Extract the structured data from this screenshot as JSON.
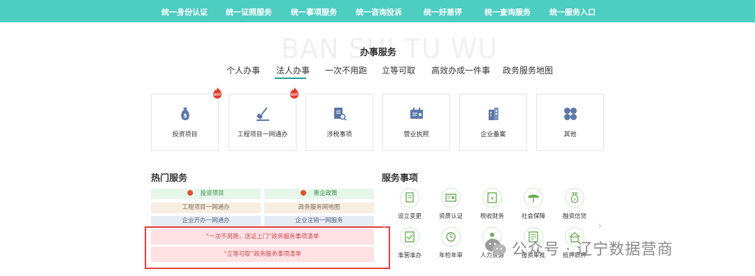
{
  "top_nav": {
    "items": [
      "统一身份认证",
      "统一证照服务",
      "统一事项服务",
      "统一咨询投诉",
      "统一好差评",
      "统一查询服务",
      "统一服务入口"
    ]
  },
  "section": {
    "bg_word": "BAN SHI TU WU",
    "title": "办事服务",
    "tabs": [
      "个人办事",
      "法人办事",
      "一次不用跑",
      "立等可取",
      "高效办成一件事",
      "政务服务地图"
    ],
    "active_tab": "法人办事"
  },
  "cards": [
    {
      "label": "投资项目",
      "icon": "money-bag-icon",
      "hot": false
    },
    {
      "label": "工程项目一网通办",
      "icon": "shovel-icon",
      "hot": true
    },
    {
      "label": "涉税事项",
      "icon": "document-search-icon",
      "hot": true
    },
    {
      "label": "营业执照",
      "icon": "license-icon",
      "hot": false
    },
    {
      "label": "企业备案",
      "icon": "building-icon",
      "hot": false
    },
    {
      "label": "其他",
      "icon": "grid-icon",
      "hot": false
    }
  ],
  "hot_badge": "HOT",
  "hot_services": {
    "title": "热门服务",
    "items": [
      "投资项目",
      "惠企政策",
      "工程项目一网通办",
      "政务服务网地图",
      "企业开办一网通办",
      "企业注销一网服务"
    ],
    "wide_items": [
      "“一次不用跑，送证上门”政务服务事项清单",
      "“立等可取”政务服务事项清单"
    ]
  },
  "service_matters": {
    "title": "服务事项",
    "row1": [
      {
        "label": "设立变更",
        "icon": "register-icon"
      },
      {
        "label": "资质认证",
        "icon": "certificate-icon"
      },
      {
        "label": "税收财务",
        "icon": "tax-icon"
      },
      {
        "label": "社会保障",
        "icon": "umbrella-icon"
      },
      {
        "label": "融资信贷",
        "icon": "finance-bag-icon"
      }
    ],
    "row2": [
      {
        "label": "准营准办",
        "icon": "permit-icon"
      },
      {
        "label": "年检年审",
        "icon": "clock-icon"
      },
      {
        "label": "人力资源",
        "icon": "person-icon"
      },
      {
        "label": "投资审批",
        "icon": "approval-icon"
      },
      {
        "label": "抵押质押",
        "icon": "mortgage-icon"
      }
    ]
  },
  "watermark": {
    "text": "公众号 · 辽宁数据营商"
  },
  "colors": {
    "nav_bg": "#4ecdc1",
    "accent": "#1aa093",
    "highlight_border": "#e5393b"
  }
}
